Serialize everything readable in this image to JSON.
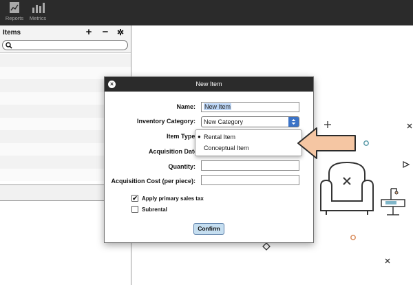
{
  "toolbar": {
    "items": [
      {
        "label": "Reports",
        "icon": "reports-icon"
      },
      {
        "label": "Metrics",
        "icon": "metrics-icon"
      }
    ]
  },
  "left_pane": {
    "title": "Items",
    "add_label": "+",
    "remove_label": "−",
    "settings_label": "✲",
    "search": {
      "value": "",
      "placeholder": ""
    }
  },
  "dialog": {
    "title": "New Item",
    "close_label": "×",
    "fields": {
      "name": {
        "label": "Name:",
        "value": "New Item"
      },
      "category": {
        "label": "Inventory Category:",
        "value": "New Category"
      },
      "item_type": {
        "label": "Item Type"
      },
      "acquisition_date": {
        "label": "Acquisition Date"
      },
      "quantity": {
        "label": "Quantity:",
        "value": ""
      },
      "acquisition_cost": {
        "label": "Acquisition Cost (per piece):",
        "value": ""
      }
    },
    "item_type_options": [
      {
        "label": "Rental Item",
        "selected": true
      },
      {
        "label": "Conceptual Item",
        "selected": false
      }
    ],
    "checkboxes": [
      {
        "label": "Apply primary sales tax",
        "checked": true,
        "mark": "✔"
      },
      {
        "label": "Subrental",
        "checked": false,
        "mark": ""
      }
    ],
    "confirm_label": "Confirm"
  },
  "colors": {
    "toolbar_bg": "#2b2b2b",
    "select_arrow": "#3b73c7",
    "confirm_bg": "#c5def0",
    "annotation_arrow": "#f5c6a3",
    "annotation_arrow_stroke": "#2b2b2b"
  }
}
